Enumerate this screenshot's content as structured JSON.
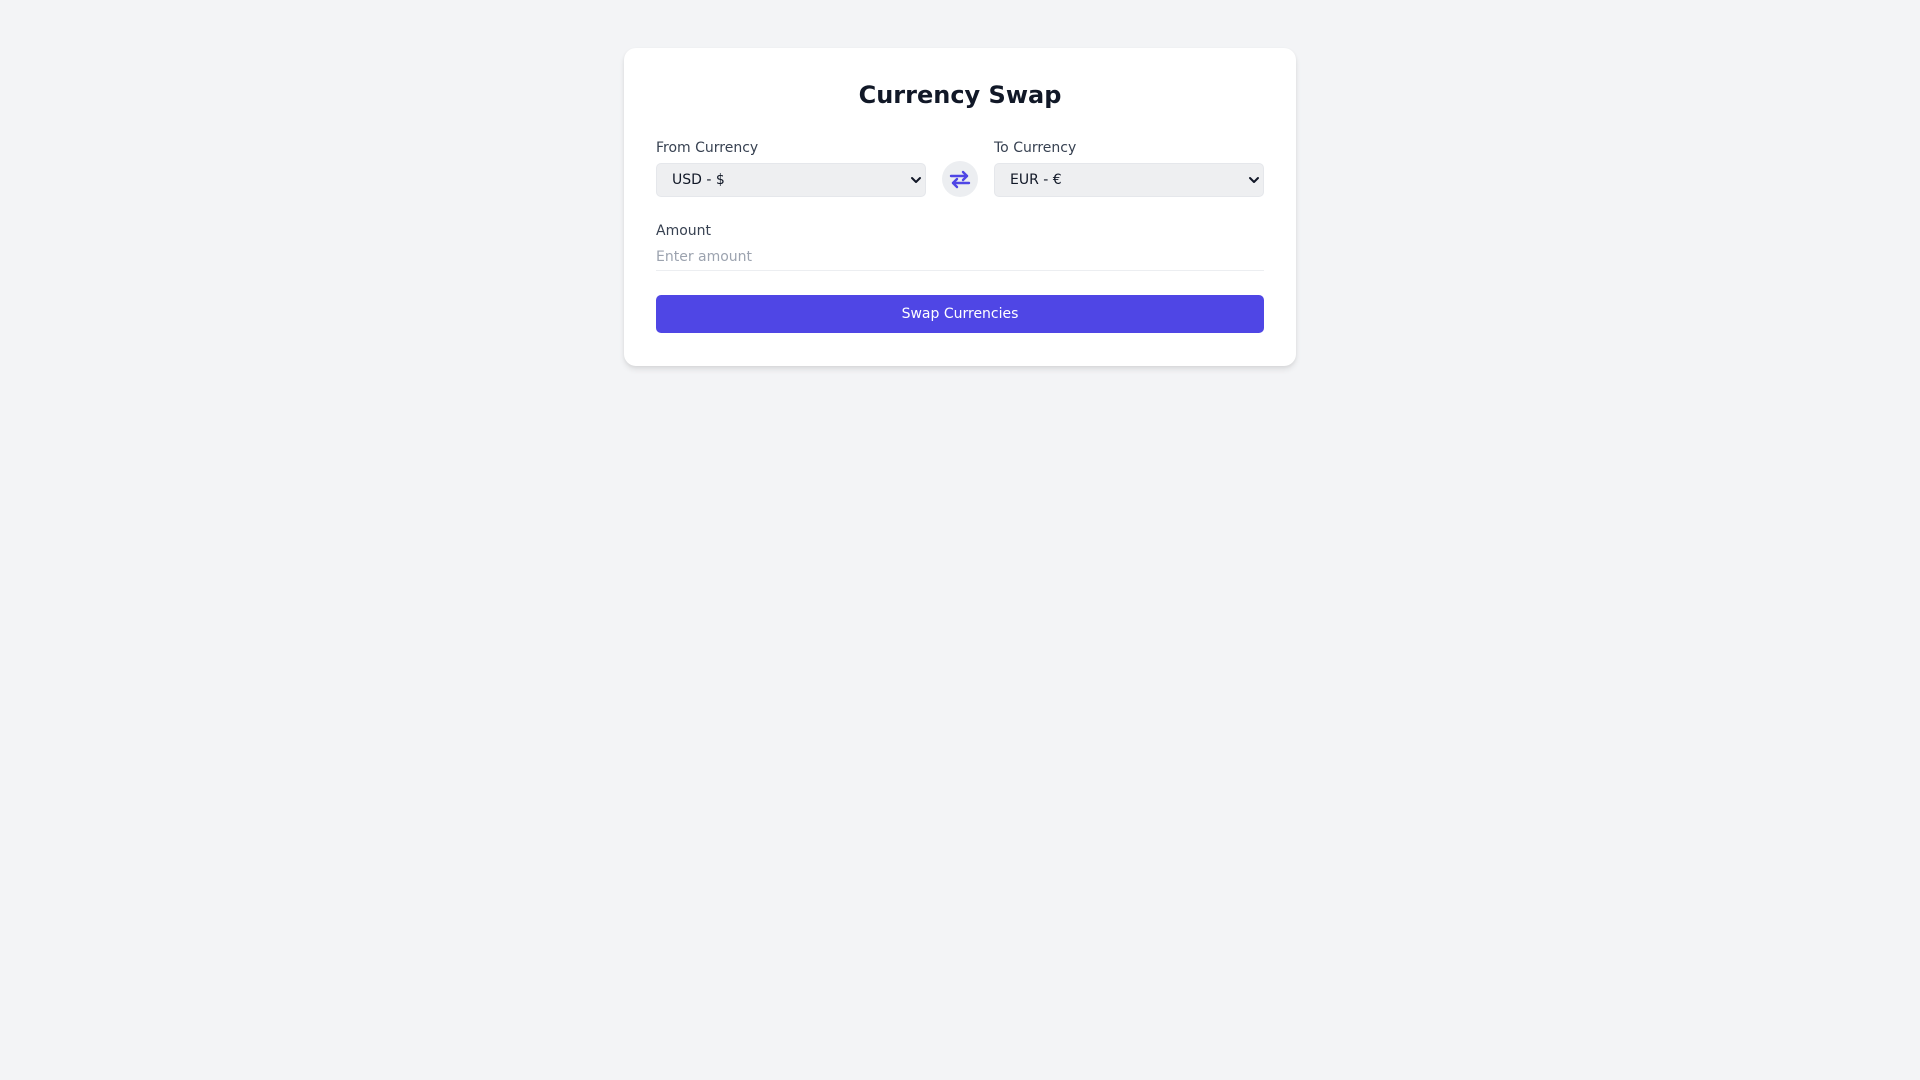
{
  "card": {
    "title": "Currency Swap"
  },
  "from": {
    "label": "From Currency",
    "selected": "USD - $"
  },
  "to": {
    "label": "To Currency",
    "selected": "EUR - €"
  },
  "swap_icon": "swap-arrows-icon",
  "amount": {
    "label": "Amount",
    "placeholder": "Enter amount",
    "value": ""
  },
  "submit": {
    "label": "Swap Currencies"
  },
  "colors": {
    "accent": "#4f46e5",
    "background": "#f3f4f6",
    "card": "#ffffff"
  }
}
